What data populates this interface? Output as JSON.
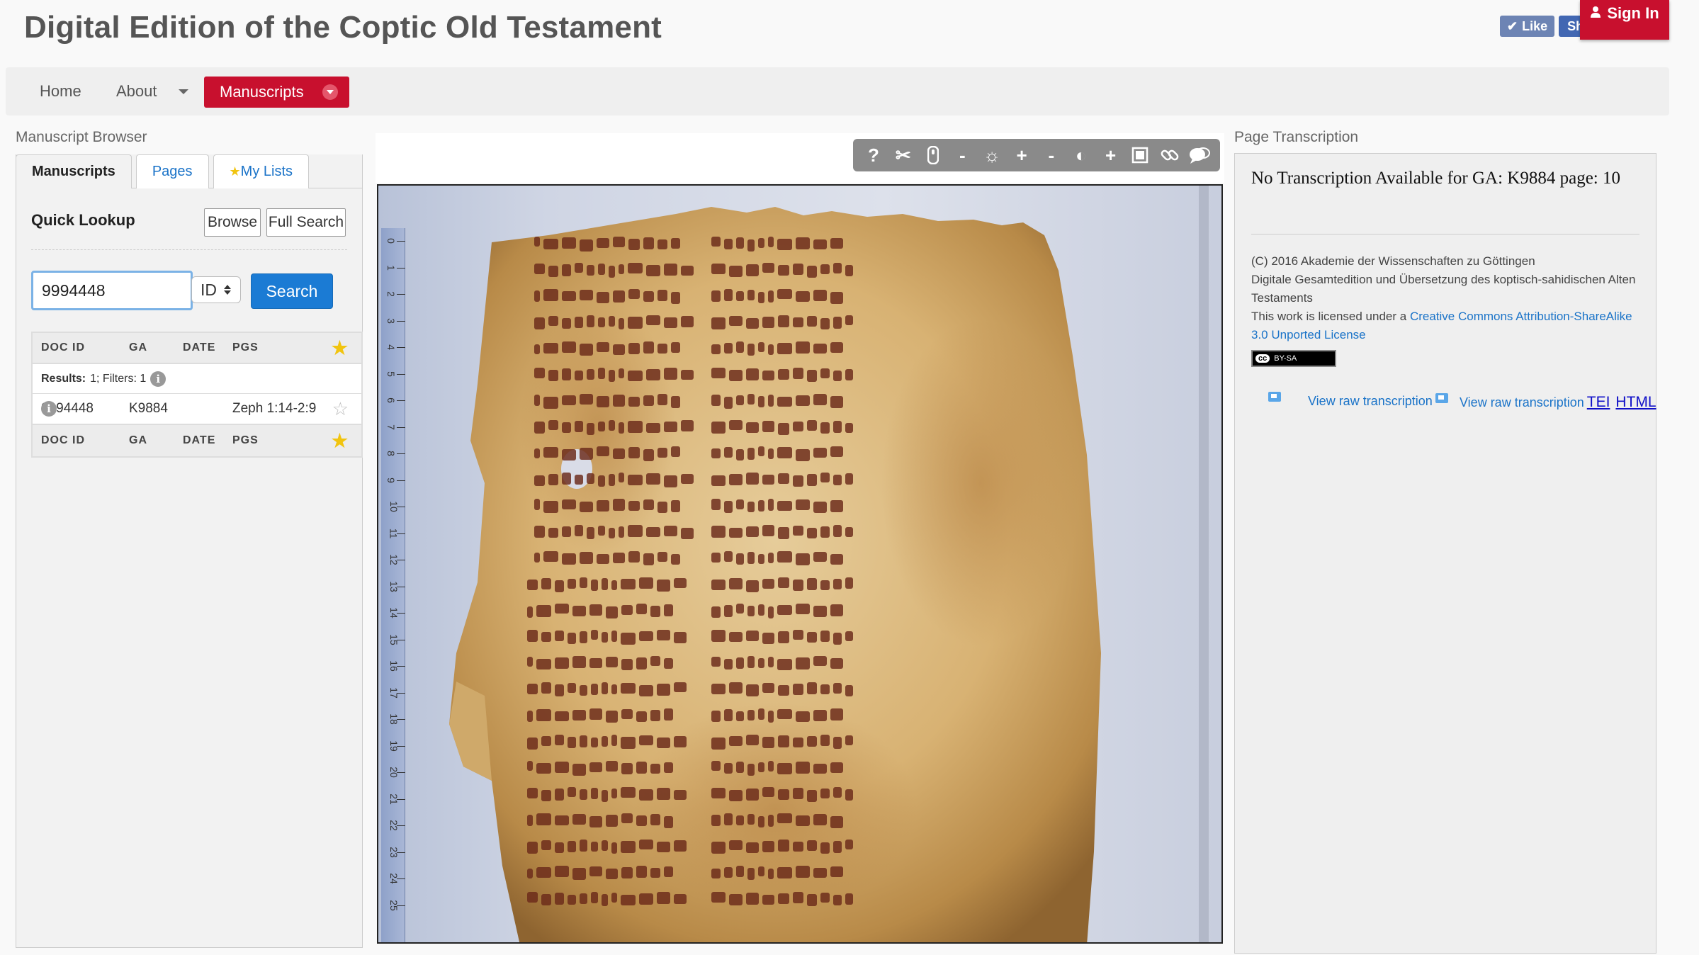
{
  "header": {
    "title": "Digital Edition of the Coptic Old Testament",
    "like_label": "Like",
    "share_label": "Sh",
    "signin_label": "Sign In"
  },
  "nav": {
    "home": "Home",
    "about": "About",
    "manuscripts": "Manuscripts"
  },
  "browser": {
    "label": "Manuscript Browser",
    "tabs": [
      "Manuscripts",
      "Pages",
      "My Lists"
    ],
    "quick_lookup": "Quick Lookup",
    "browse_label": "Browse",
    "full_search_label": "Full Search",
    "search_value": "9994448",
    "id_select": "ID",
    "search_button": "Search",
    "columns": [
      "DOC ID",
      "GA",
      "DATE",
      "PGS"
    ],
    "results_label": "Results:",
    "results_info": "1; Filters: 1",
    "rows": [
      {
        "doc_id": "9994448",
        "ga": "K9884",
        "date": "",
        "pgs": "Zeph 1:14-2:9"
      }
    ]
  },
  "viewer": {
    "tools": [
      "help-icon",
      "scissors-icon",
      "hand-icon",
      "zoom-out-icon",
      "brightness-icon",
      "zoom-in-icon",
      "contrast-minus-icon",
      "contrast-icon",
      "contrast-plus-icon",
      "fullscreen-icon",
      "link-icon",
      "comment-icon"
    ],
    "ruler_numbers": [
      "0",
      "1",
      "2",
      "3",
      "4",
      "5",
      "6",
      "7",
      "8",
      "9",
      "10",
      "11",
      "12",
      "13",
      "14",
      "15",
      "16",
      "17",
      "18",
      "19",
      "20",
      "21",
      "22",
      "23",
      "24",
      "25"
    ],
    "colors": {
      "parchment": "#d9b57a",
      "ink": "#6b2a1a",
      "background": "#d9dce7"
    }
  },
  "transcription": {
    "label": "Page Transcription",
    "title": "No Transcription Available for GA: K9884 page: 10",
    "copyright": "(C) 2016 Akademie der Wissenschaften zu Göttingen",
    "project": "Digitale Gesamtedition und Übersetzung des koptisch-sahidischen Alten Testaments",
    "license_prefix": "This work is licensed under a ",
    "license_link": "Creative Commons Attribution-ShareAlike 3.0 Unported License",
    "badge": "BY-SA",
    "raw_link_1": "View raw transcription",
    "raw_link_2": "View raw transcription",
    "tei": "TEI",
    "html": "HTML"
  },
  "colors": {
    "accent": "#c8102e",
    "link": "#1a73c8",
    "primary_button": "#1b7bd4"
  }
}
